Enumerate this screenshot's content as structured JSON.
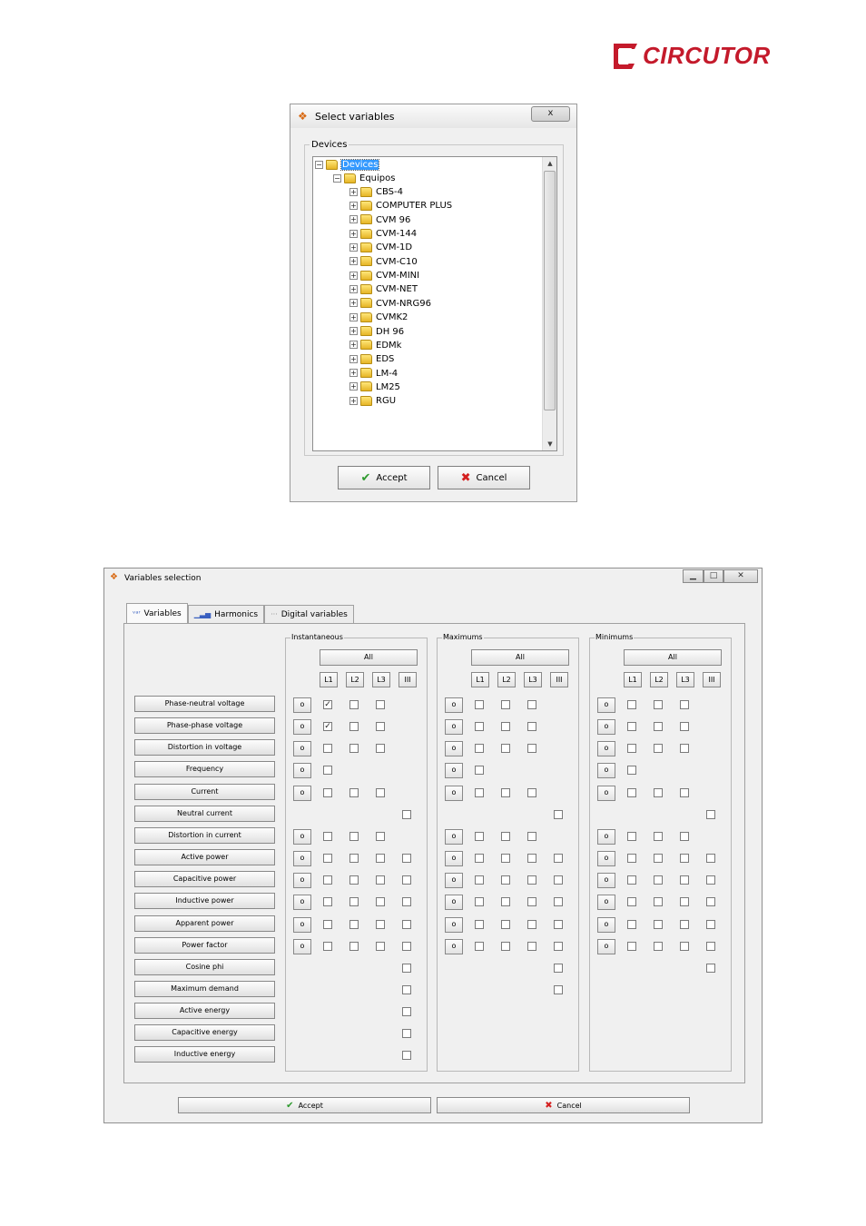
{
  "brand": {
    "logo_text": "CIRCUTOR",
    "color": "#c41a2b"
  },
  "select_dialog": {
    "title": "Select  variables",
    "close_label": "x",
    "group_label": "Devices",
    "tree": {
      "root": "Devices",
      "folder": "Equipos",
      "items": [
        "CBS-4",
        "COMPUTER PLUS",
        "CVM 96",
        "CVM-144",
        "CVM-1D",
        "CVM-C10",
        "CVM-MINI",
        "CVM-NET",
        "CVM-NRG96",
        "CVMK2",
        "DH 96",
        "EDMk",
        "EDS",
        "LM-4",
        "LM25",
        "RGU"
      ]
    },
    "accept_label": "Accept",
    "cancel_label": "Cancel"
  },
  "variables_dialog": {
    "title": "Variables selection",
    "tabs": [
      {
        "label": "Variables",
        "icon": "variables-icon"
      },
      {
        "label": "Harmonics",
        "icon": "bar-chart-icon"
      },
      {
        "label": "Digital variables",
        "icon": "digital-icon"
      }
    ],
    "groups": [
      {
        "label": "Instantaneous",
        "all_label": "All"
      },
      {
        "label": "Maximums",
        "all_label": "All"
      },
      {
        "label": "Minimums",
        "all_label": "All"
      }
    ],
    "line_labels": [
      "L1",
      "L2",
      "L3",
      "III"
    ],
    "row_button_label": "o",
    "variables": [
      "Phase-neutral voltage",
      "Phase-phase voltage",
      "Distortion in voltage",
      "Frequency",
      "Current",
      "Neutral current",
      "Distortion in current",
      "Active power",
      "Capacitive power",
      "Inductive power",
      "Apparent power",
      "Power factor",
      "Cosine phi",
      "Maximum demand",
      "Active energy",
      "Capacitive energy",
      "Inductive energy"
    ],
    "accept_label": "Accept",
    "cancel_label": "Cancel"
  }
}
